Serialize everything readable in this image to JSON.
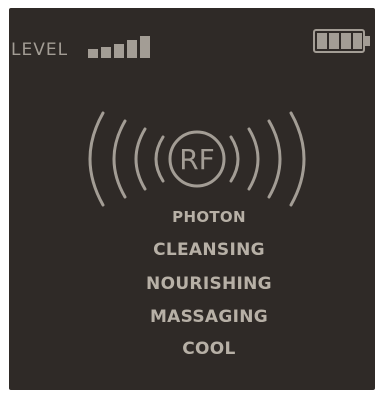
{
  "status_bar": {
    "level_label": "LEVEL",
    "level_value": 4,
    "level_max": 5,
    "battery_level": 4,
    "battery_max": 4
  },
  "emblem": {
    "text": "RF"
  },
  "modes": [
    {
      "label": "PHOTON"
    },
    {
      "label": "CLEANSING"
    },
    {
      "label": "NOURISHING"
    },
    {
      "label": "MASSAGING"
    },
    {
      "label": "COOL"
    }
  ],
  "colors": {
    "screen_background": "#2f2a27",
    "foreground": "#a39d95",
    "mode_text": "#b7b0a6"
  },
  "icons": {
    "level": "signal-bars-icon",
    "battery": "battery-icon",
    "emblem": "rf-waves-icon"
  }
}
